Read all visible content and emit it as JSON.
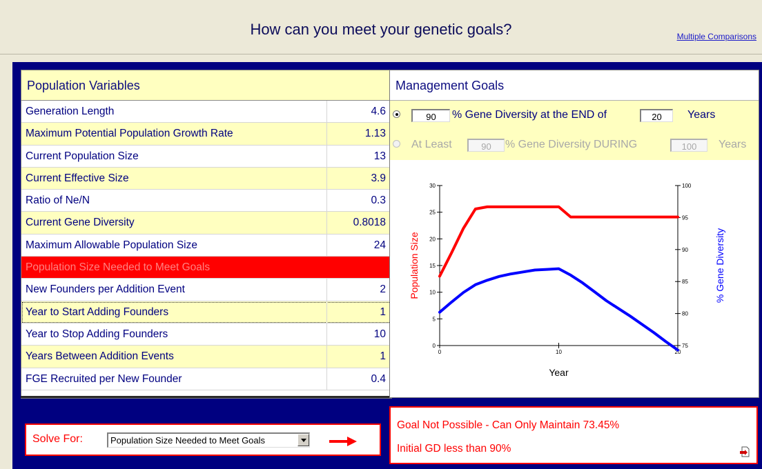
{
  "header": {
    "title": "How can you meet your genetic goals?",
    "link_label": "Multiple Comparisons"
  },
  "population": {
    "heading": "Population Variables",
    "rows": [
      {
        "label": "Generation Length",
        "value": "4.6"
      },
      {
        "label": "Maximum Potential Population Growth Rate",
        "value": "1.13"
      },
      {
        "label": "Current Population Size",
        "value": "13"
      },
      {
        "label": "Current Effective Size",
        "value": "3.9"
      },
      {
        "label": "Ratio of Ne/N",
        "value": "0.3"
      },
      {
        "label": "Current Gene Diversity",
        "value": "0.8018"
      },
      {
        "label": "Maximum Allowable Population Size",
        "value": "24"
      },
      {
        "label": "Population Size Needed to Meet Goals",
        "value": ""
      },
      {
        "label": "New Founders per Addition Event",
        "value": "2"
      },
      {
        "label": "Year to Start Adding Founders",
        "value": "1"
      },
      {
        "label": "Year to Stop Adding Founders",
        "value": "10"
      },
      {
        "label": "Years Between  Addition Events",
        "value": "1"
      },
      {
        "label": "FGE Recruited per New Founder",
        "value": "0.4"
      }
    ]
  },
  "goals": {
    "heading": "Management Goals",
    "option1": {
      "value1": "90",
      "text1": "% Gene Diversity at the END of",
      "value2": "20",
      "text2": "Years"
    },
    "option2": {
      "prefix": "At Least",
      "value1": "90",
      "text1": "% Gene Diversity DURING",
      "value2": "100",
      "text2": "Years"
    }
  },
  "solve": {
    "label": "Solve For:",
    "selected": "Population Size Needed to Meet Goals"
  },
  "result": {
    "line1": "Goal Not Possible - Can Only Maintain 73.45%",
    "line2": "Initial GD less than 90%"
  },
  "chart_data": {
    "type": "line",
    "xlabel": "Year",
    "ylabel_left": "Population Size",
    "ylabel_right": "% Gene Diversity",
    "xlim": [
      0,
      20
    ],
    "x_ticks": [
      0,
      10,
      20
    ],
    "ylim_left": [
      0,
      30
    ],
    "y_ticks_left": [
      0,
      5,
      10,
      15,
      20,
      25,
      30
    ],
    "ylim_right": [
      75,
      100
    ],
    "y_ticks_right": [
      75,
      80,
      85,
      90,
      95,
      100
    ],
    "grid": false,
    "series": [
      {
        "color": "#ff0000",
        "axis": "left",
        "x": [
          0,
          1,
          2,
          3,
          4,
          5,
          6,
          7,
          8,
          9,
          10,
          11,
          12,
          13,
          14,
          15,
          16,
          17,
          18,
          19,
          20
        ],
        "y": [
          13,
          17.4,
          22,
          25.6,
          26,
          26,
          26,
          26,
          26,
          26,
          26,
          24.1,
          24.1,
          24.1,
          24.1,
          24.1,
          24.1,
          24.1,
          24.1,
          24.1,
          24.1
        ]
      },
      {
        "color": "#0000ff",
        "axis": "right",
        "x": [
          0,
          1,
          2,
          3,
          4,
          5,
          6,
          7,
          8,
          9,
          10,
          11,
          12,
          13,
          14,
          15,
          16,
          17,
          18,
          19,
          20
        ],
        "y": [
          80.2,
          81.8,
          83.3,
          84.5,
          85.2,
          85.8,
          86.2,
          86.5,
          86.8,
          86.9,
          87.0,
          86.0,
          84.8,
          83.4,
          82.0,
          80.8,
          79.6,
          78.3,
          77.0,
          75.6,
          74.3
        ]
      }
    ]
  },
  "icons": {
    "export": "export-icon",
    "arrow": "right-arrow-icon"
  },
  "colors": {
    "background_blue": "#000080",
    "row_yellow": "#ffffc0",
    "highlight_red": "#ff0000"
  }
}
